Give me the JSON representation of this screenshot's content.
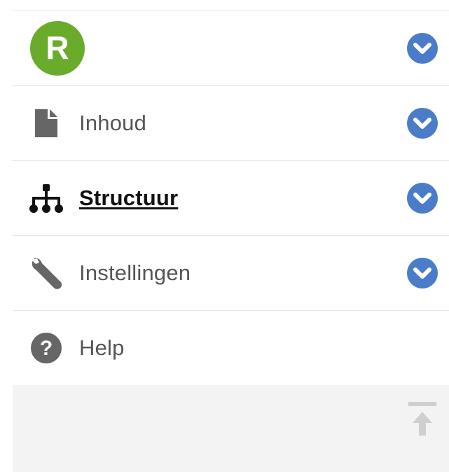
{
  "menu": {
    "logo": {
      "letter": "R",
      "color": "#6aab2b",
      "icon": "logo-r-icon"
    },
    "items": [
      {
        "label": "Inhoud",
        "icon": "document-icon",
        "expandable": true
      },
      {
        "label": "Structuur",
        "icon": "sitemap-icon",
        "expandable": true,
        "active": true
      },
      {
        "label": "Instellingen",
        "icon": "wrench-icon",
        "expandable": true
      },
      {
        "label": "Help",
        "icon": "question-circle-icon",
        "expandable": false
      }
    ]
  },
  "colors": {
    "chevron": "#4a7cc9",
    "icon": "#666666",
    "active_text": "#111111"
  },
  "footer": {
    "icon": "scroll-to-top-icon"
  }
}
